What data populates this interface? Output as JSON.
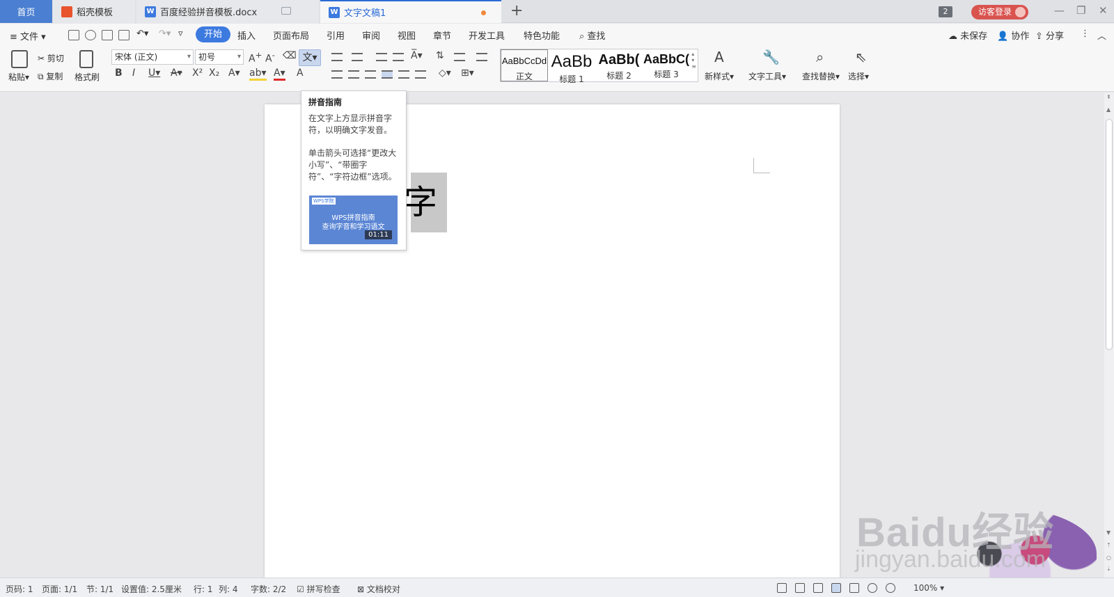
{
  "tabs": {
    "home": "首页",
    "tab1": "稻壳模板",
    "tab2": "百度经验拼音模板.docx",
    "tab3": "文字文稿1",
    "badge_count": "2",
    "login": "访客登录"
  },
  "menu": {
    "file": "文件",
    "items": [
      "开始",
      "插入",
      "页面布局",
      "引用",
      "审阅",
      "视图",
      "章节",
      "开发工具",
      "特色功能"
    ],
    "find": "查找",
    "unsaved": "未保存",
    "collab": "协作",
    "share": "分享"
  },
  "ribbon": {
    "paste": "粘贴",
    "cut": "剪切",
    "copy": "复制",
    "format_painter": "格式刷",
    "font_name": "宋体 (正文)",
    "font_size": "初号",
    "pinyin_glyph": "文",
    "styles": [
      {
        "preview": "AaBbCcDd",
        "name": "正文"
      },
      {
        "preview": "AaBb",
        "name": "标题 1"
      },
      {
        "preview": "AaBb(",
        "name": "标题 2"
      },
      {
        "preview": "AaBbC(",
        "name": "标题 3"
      }
    ],
    "new_style": "新样式",
    "text_tools": "文字工具",
    "find_replace": "查找替换",
    "select": "选择"
  },
  "tooltip": {
    "title": "拼音指南",
    "desc1": "在文字上方显示拼音字符，以明确文字发音。",
    "desc2": "单击箭头可选择“更改大小写”、“带圈字符”、“字符边框”选项。",
    "video_logo": "WPS学院",
    "video_line1": "WPS拼音指南",
    "video_line2": "查询字音和学习语文",
    "video_duration": "01:11"
  },
  "document": {
    "selected_char": "字"
  },
  "status": {
    "page": "页码: 1",
    "pages": "页面: 1/1",
    "section": "节: 1/1",
    "setting": "设置值: 2.5厘米",
    "row": "行: 1",
    "col": "列: 4",
    "chars": "字数: 2/2",
    "spell": "拼写检查",
    "proof": "文档校对",
    "zoom": "100%"
  },
  "watermark": {
    "brand": "Baidu经验",
    "url": "jingyan.baidu.com"
  },
  "colors": {
    "accent": "#3d7ae0",
    "login": "#d9534f"
  }
}
